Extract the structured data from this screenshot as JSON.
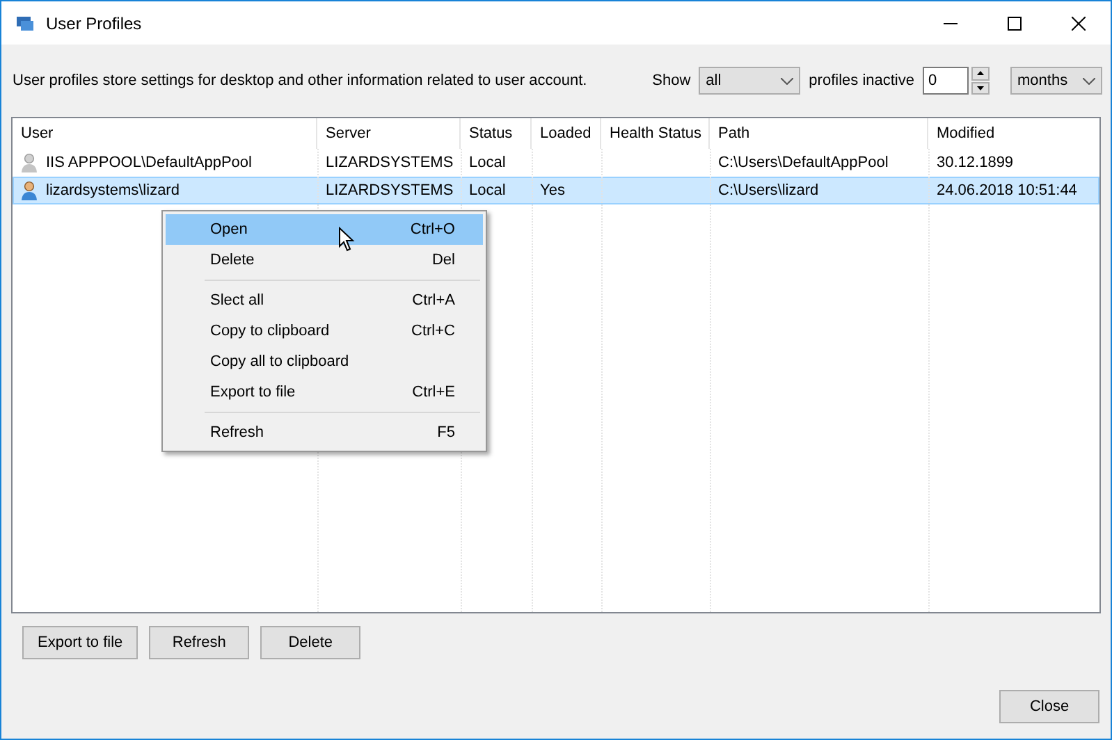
{
  "window": {
    "title": "User Profiles"
  },
  "description": "User profiles store settings for desktop and other information related to user account.",
  "filter": {
    "show_label": "Show",
    "show_value": "all",
    "inactive_label": "profiles inactive",
    "inactive_value": "0",
    "unit_value": "months"
  },
  "table": {
    "columns": [
      "User",
      "Server",
      "Status",
      "Loaded",
      "Health Status",
      "Path",
      "Modified"
    ],
    "rows": [
      {
        "kind": "generic",
        "selected": false,
        "cells": [
          "IIS APPPOOL\\DefaultAppPool",
          "LIZARDSYSTEMS",
          "Local",
          "",
          "",
          "C:\\Users\\DefaultAppPool",
          "30.12.1899"
        ]
      },
      {
        "kind": "person",
        "selected": true,
        "cells": [
          "lizardsystems\\lizard",
          "LIZARDSYSTEMS",
          "Local",
          "Yes",
          "",
          "C:\\Users\\lizard",
          "24.06.2018 10:51:44"
        ]
      }
    ]
  },
  "context_menu": [
    {
      "kind": "item",
      "label": "Open",
      "shortcut": "Ctrl+O",
      "selected": true
    },
    {
      "kind": "item",
      "label": "Delete",
      "shortcut": "Del",
      "selected": false
    },
    {
      "kind": "separator"
    },
    {
      "kind": "item",
      "label": "Slect all",
      "shortcut": "Ctrl+A",
      "selected": false
    },
    {
      "kind": "item",
      "label": "Copy to clipboard",
      "shortcut": "Ctrl+C",
      "selected": false
    },
    {
      "kind": "item",
      "label": "Copy all to clipboard",
      "selected": false
    },
    {
      "kind": "item",
      "label": "Export to file",
      "shortcut": "Ctrl+E",
      "selected": false
    },
    {
      "kind": "separator"
    },
    {
      "kind": "item",
      "label": "Refresh",
      "shortcut": "F5",
      "selected": false
    }
  ],
  "buttons": [
    "Export to file",
    "Refresh",
    "Delete"
  ],
  "close_button": "Close"
}
